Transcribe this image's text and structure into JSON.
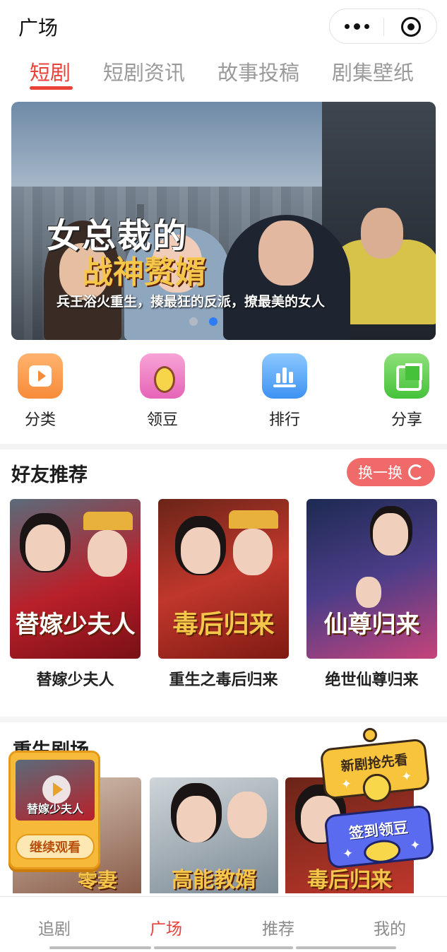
{
  "header": {
    "title": "广场"
  },
  "tabs": [
    {
      "label": "短剧",
      "active": true
    },
    {
      "label": "短剧资讯",
      "active": false
    },
    {
      "label": "故事投稿",
      "active": false
    },
    {
      "label": "剧集壁纸",
      "active": false
    }
  ],
  "banner": {
    "title_line1": "女总裁的",
    "title_line2": "战神赘婿",
    "subtitle": "兵王浴火重生，揍最狂的反派，撩最美的女人",
    "slides": 2,
    "active_slide": 2
  },
  "quick_entries": [
    {
      "label": "分类",
      "icon": "video-category-icon"
    },
    {
      "label": "领豆",
      "icon": "coin-bean-icon"
    },
    {
      "label": "排行",
      "icon": "ranking-chart-icon"
    },
    {
      "label": "分享",
      "icon": "share-icon"
    }
  ],
  "friends": {
    "title": "好友推荐",
    "refresh_label": "换一换",
    "items": [
      {
        "title": "替嫁少夫人",
        "poster_text": "替嫁少夫人"
      },
      {
        "title": "重生之毒后归来",
        "poster_text": "毒后归来"
      },
      {
        "title": "绝世仙尊归来",
        "poster_text": "仙尊归来"
      }
    ]
  },
  "rebirth": {
    "title": "重生剧场",
    "cards": [
      "零妻",
      "高能教婿",
      "毒后归来"
    ]
  },
  "floating": {
    "continue_label": "继续观看",
    "continue_thumb_text": "替嫁少夫人",
    "promo_new": "新剧抢先看",
    "promo_checkin": "签到领豆"
  },
  "bottom_nav": [
    {
      "label": "追剧",
      "active": false
    },
    {
      "label": "广场",
      "active": true
    },
    {
      "label": "推荐",
      "active": false
    },
    {
      "label": "我的",
      "active": false
    }
  ],
  "colors": {
    "accent": "#e8423a",
    "inactive": "#9a9a9a",
    "refresh_bg": "#f06a6a"
  }
}
